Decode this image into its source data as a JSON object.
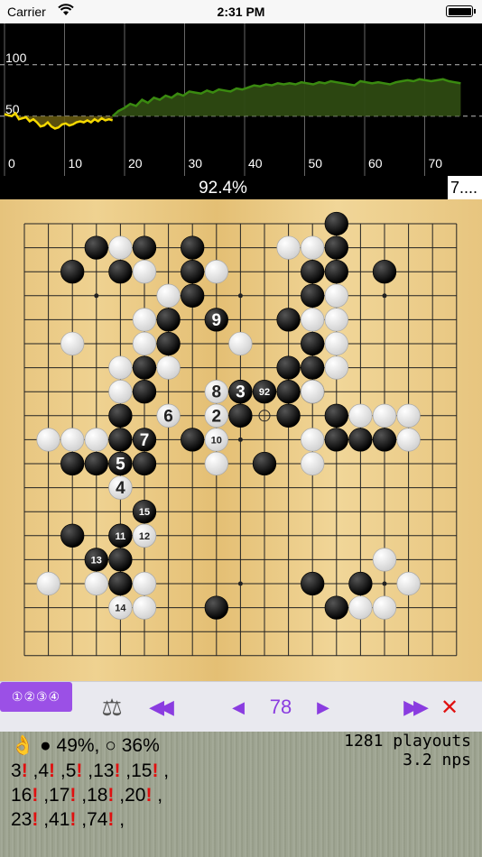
{
  "status_bar": {
    "carrier": "Carrier",
    "time": "2:31 PM"
  },
  "graph": {
    "y_labels": [
      "100",
      "50"
    ],
    "x_labels": [
      "0",
      "10",
      "20",
      "30",
      "40",
      "50",
      "60",
      "70"
    ],
    "yellow": [
      52,
      51,
      50,
      53,
      47,
      48,
      49,
      45,
      47,
      44,
      40,
      41,
      44,
      40,
      38,
      39,
      42,
      43,
      41,
      42,
      44,
      45,
      44,
      46,
      44,
      47,
      45,
      48,
      46,
      47,
      46
    ],
    "green": [
      50,
      55,
      58,
      62,
      60,
      66,
      63,
      68,
      66,
      70,
      68,
      72,
      70,
      74,
      73,
      72,
      75,
      73,
      76,
      75,
      74,
      77,
      76,
      78,
      80,
      79,
      81,
      80,
      82,
      81,
      82,
      81,
      83,
      82,
      81,
      83,
      82,
      84,
      83,
      82,
      81,
      80,
      84,
      83,
      82,
      83,
      82,
      81,
      83,
      84,
      85,
      84,
      86,
      85,
      84,
      85,
      86,
      84,
      83,
      82
    ],
    "accent_yellow": "#f5d800",
    "accent_green": "#3a8a10"
  },
  "win_bar": {
    "percent": "92.4%",
    "komi": "7...."
  },
  "board": {
    "size": 19,
    "stars": [
      [
        3,
        3
      ],
      [
        9,
        3
      ],
      [
        15,
        3
      ],
      [
        3,
        9
      ],
      [
        9,
        9
      ],
      [
        15,
        9
      ],
      [
        3,
        15
      ],
      [
        9,
        15
      ],
      [
        15,
        15
      ]
    ],
    "black": [
      [
        13,
        0
      ],
      [
        3,
        1
      ],
      [
        5,
        1
      ],
      [
        7,
        1
      ],
      [
        13,
        1
      ],
      [
        2,
        2
      ],
      [
        4,
        2
      ],
      [
        7,
        2
      ],
      [
        12,
        2
      ],
      [
        13,
        2
      ],
      [
        15,
        2
      ],
      [
        7,
        3
      ],
      [
        12,
        3
      ],
      [
        6,
        4
      ],
      [
        11,
        4
      ],
      [
        6,
        5
      ],
      [
        12,
        5
      ],
      [
        5,
        6
      ],
      [
        11,
        6
      ],
      [
        12,
        6
      ],
      [
        5,
        7
      ],
      [
        9,
        7
      ],
      [
        11,
        7
      ],
      [
        12,
        7
      ],
      [
        4,
        8
      ],
      [
        9,
        8
      ],
      [
        11,
        8
      ],
      [
        13,
        8
      ],
      [
        4,
        9
      ],
      [
        7,
        9
      ],
      [
        13,
        9
      ],
      [
        14,
        9
      ],
      [
        15,
        9
      ],
      [
        2,
        10
      ],
      [
        3,
        10
      ],
      [
        4,
        10
      ],
      [
        5,
        10
      ],
      [
        10,
        10
      ],
      [
        4,
        13
      ],
      [
        2,
        13
      ],
      [
        4,
        14
      ],
      [
        4,
        15
      ],
      [
        12,
        15
      ],
      [
        14,
        15
      ],
      [
        8,
        16
      ],
      [
        13,
        16
      ]
    ],
    "white": [
      [
        4,
        1
      ],
      [
        11,
        1
      ],
      [
        12,
        1
      ],
      [
        5,
        2
      ],
      [
        8,
        2
      ],
      [
        6,
        3
      ],
      [
        13,
        3
      ],
      [
        5,
        4
      ],
      [
        12,
        4
      ],
      [
        13,
        4
      ],
      [
        2,
        5
      ],
      [
        5,
        5
      ],
      [
        9,
        5
      ],
      [
        13,
        5
      ],
      [
        4,
        6
      ],
      [
        6,
        6
      ],
      [
        13,
        6
      ],
      [
        4,
        7
      ],
      [
        12,
        7
      ],
      [
        14,
        8
      ],
      [
        15,
        8
      ],
      [
        16,
        8
      ],
      [
        1,
        9
      ],
      [
        2,
        9
      ],
      [
        3,
        9
      ],
      [
        12,
        9
      ],
      [
        16,
        9
      ],
      [
        8,
        10
      ],
      [
        12,
        10
      ],
      [
        4,
        11
      ],
      [
        5,
        13
      ],
      [
        15,
        14
      ],
      [
        1,
        15
      ],
      [
        3,
        15
      ],
      [
        5,
        15
      ],
      [
        16,
        15
      ],
      [
        5,
        16
      ],
      [
        14,
        16
      ],
      [
        15,
        16
      ],
      [
        4,
        16
      ]
    ],
    "numbered": [
      {
        "x": 8,
        "y": 4,
        "n": "9",
        "color": "black"
      },
      {
        "x": 8,
        "y": 7,
        "n": "8",
        "color": "white"
      },
      {
        "x": 9,
        "y": 7,
        "n": "3",
        "color": "black"
      },
      {
        "x": 10,
        "y": 7,
        "n": "92",
        "color": "black"
      },
      {
        "x": 6,
        "y": 8,
        "n": "6",
        "color": "white"
      },
      {
        "x": 8,
        "y": 8,
        "n": "2",
        "color": "white"
      },
      {
        "x": 5,
        "y": 9,
        "n": "7",
        "color": "black"
      },
      {
        "x": 8,
        "y": 9,
        "n": "10",
        "color": "white"
      },
      {
        "x": 4,
        "y": 10,
        "n": "5",
        "color": "black"
      },
      {
        "x": 4,
        "y": 11,
        "n": "4",
        "color": "white"
      },
      {
        "x": 5,
        "y": 12,
        "n": "15",
        "color": "black"
      },
      {
        "x": 4,
        "y": 13,
        "n": "11",
        "color": "black"
      },
      {
        "x": 5,
        "y": 13,
        "n": "12",
        "color": "white"
      },
      {
        "x": 3,
        "y": 14,
        "n": "13",
        "color": "black"
      },
      {
        "x": 4,
        "y": 16,
        "n": "14",
        "color": "white"
      }
    ],
    "marker": [
      10,
      8
    ]
  },
  "toolbar": {
    "numbers_toggle": "①②③④",
    "balance_icon": "⚖",
    "rewind_icon": "◀◀",
    "prev_icon": "◀",
    "move_number": "78",
    "next_icon": "▶",
    "fastforward_icon": "▶▶",
    "close_icon": "✕"
  },
  "info": {
    "ok_hand": "👌",
    "black_rate": "● 49%,",
    "white_rate": "○ 36%",
    "playouts": "1281 playouts",
    "nps": "3.2 nps",
    "hot_lines": [
      [
        "3",
        "4",
        "5",
        "13",
        "15"
      ],
      [
        "16",
        "17",
        "18",
        "20"
      ],
      [
        "23",
        "41",
        "74"
      ]
    ]
  }
}
